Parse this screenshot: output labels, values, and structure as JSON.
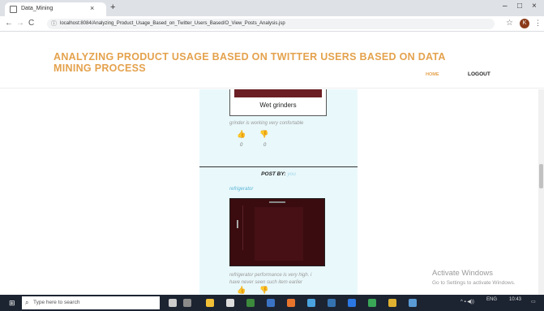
{
  "browser": {
    "tab_title": "Data_Mining",
    "tab_close": "×",
    "new_tab": "+",
    "minimize": "–",
    "maximize": "□",
    "close": "×",
    "back": "←",
    "forward": "→",
    "reload": "C",
    "url": "localhost:8084/Analyzing_Product_Usage_Based_on_Twitter_Users_Based/O_View_Posts_Analysis.jsp",
    "profile_initial": "K"
  },
  "header": {
    "title": "ANALYZING PRODUCT USAGE BASED ON TWITTER USERS BASED ON DATA MINING PROCESS",
    "nav": {
      "home": "HOME",
      "logout": "LOGOUT"
    }
  },
  "posts": [
    {
      "product_label": "Wet grinders",
      "description": "grinder is working very confortable",
      "likes": "0",
      "dislikes": "0"
    },
    {
      "post_by_label": "POST BY:",
      "post_by_user": "you",
      "product_name": "refrigerator",
      "description_line1": "refrigerator performance is very high. i",
      "description_line2": "have never seen such item earlier"
    }
  ],
  "watermark": {
    "line1": "Activate Windows",
    "line2": "Go to Settings to activate Windows."
  },
  "taskbar": {
    "search_placeholder": "Type here to search",
    "lang": "ENG",
    "time": "10:43"
  },
  "colors": {
    "accent": "#e4a24d",
    "link": "#5ab6d6",
    "column_bg": "#e9f8fb"
  }
}
